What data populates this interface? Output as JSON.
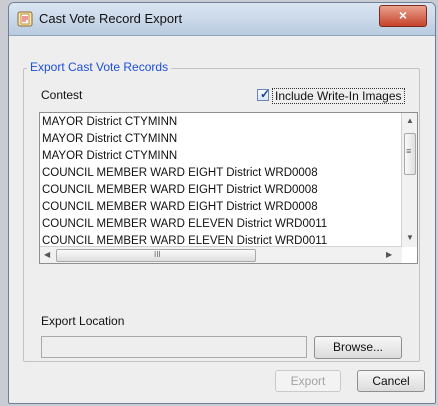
{
  "window": {
    "title": "Cast Vote Record Export",
    "close_label": "×"
  },
  "group": {
    "title": "Export Cast Vote Records"
  },
  "contest": {
    "label": "Contest",
    "include_write_in": {
      "label": "Include Write-In Images",
      "checked": true
    },
    "items": [
      "MAYOR District CTYMINN",
      "MAYOR District CTYMINN",
      "MAYOR District CTYMINN",
      "COUNCIL MEMBER WARD EIGHT District WRD0008",
      "COUNCIL MEMBER WARD EIGHT District WRD0008",
      "COUNCIL MEMBER WARD EIGHT District WRD0008",
      "COUNCIL MEMBER WARD ELEVEN District WRD0011",
      "COUNCIL MEMBER WARD ELEVEN District WRD0011"
    ]
  },
  "export_location": {
    "label": "Export Location",
    "value": "",
    "browse_label": "Browse..."
  },
  "buttons": {
    "export_label": "Export",
    "cancel_label": "Cancel"
  },
  "icons": {
    "vertical_scrollbar_grip": "≡",
    "horizontal_scrollbar_grip": "III"
  }
}
